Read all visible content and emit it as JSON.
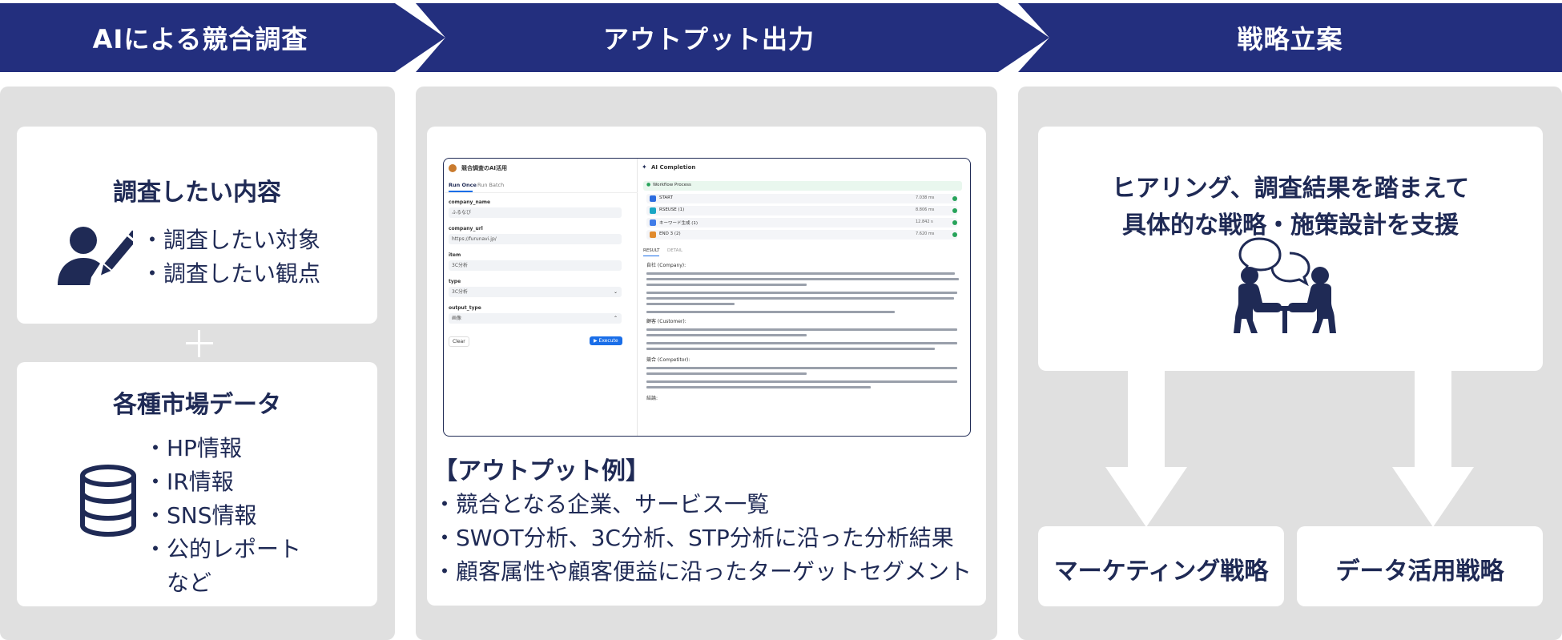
{
  "headers": [
    "AIによる競合調査",
    "アウトプット出力",
    "戦略立案"
  ],
  "left": {
    "card1": {
      "title": "調査したい内容",
      "bullets": [
        "・調査したい対象",
        "・調査したい観点"
      ]
    },
    "card2": {
      "title": "各種市場データ",
      "bullets": [
        "・HP情報",
        "・IR情報",
        "・SNS情報",
        "・公的レポート",
        "など"
      ]
    }
  },
  "mock": {
    "app_title": "競合調査のAI活用",
    "tabs": [
      "Run Once",
      "Run Batch"
    ],
    "fields": [
      {
        "label": "company_name",
        "value": "ふるなび"
      },
      {
        "label": "company_url",
        "value": "https://furunavi.jp/"
      },
      {
        "label": "item",
        "value": "3C分析"
      },
      {
        "label": "type",
        "value": "3C分析"
      },
      {
        "label": "output_type",
        "value": "画像"
      }
    ],
    "clear_label": "Clear",
    "execute_label": "▶ Execute",
    "right_title": "AI Completion",
    "workflow_label": "Workflow Process",
    "workflow_rows": [
      {
        "name": "START",
        "time": "7.038 ms"
      },
      {
        "name": "RSEUSE (1)",
        "time": "8.806 ms"
      },
      {
        "name": "キーワード生成 (1)",
        "time": "12.842 s"
      },
      {
        "name": "END 3 (2)",
        "time": "7.620 ms"
      }
    ],
    "result_tabs": [
      "RESULT",
      "DETAIL"
    ],
    "sections": [
      "自社 (Company):",
      "顧客 (Customer):",
      "競合 (Competitor):",
      "結論:"
    ]
  },
  "middle": {
    "output_title": "【アウトプット例】",
    "items": [
      "・競合となる企業、サービス一覧",
      "・SWOT分析、3C分析、STP分析に沿った分析結果",
      "・顧客属性や顧客便益に沿ったターゲットセグメント"
    ]
  },
  "right": {
    "line1": "ヒアリング、調査結果を踏まえて",
    "line2": "具体的な戦略・施策設計を支援",
    "box1": "マーケティング戦略",
    "box2": "データ活用戦略"
  },
  "colors": {
    "navy": "#232f7e",
    "text": "#1f2a55",
    "panel": "#e0e0e0",
    "accent_blue": "#1a6ee8"
  },
  "icons": [
    "person-writing-icon",
    "database-icon",
    "plus-icon",
    "meeting-icon",
    "arrow-down-icon"
  ]
}
